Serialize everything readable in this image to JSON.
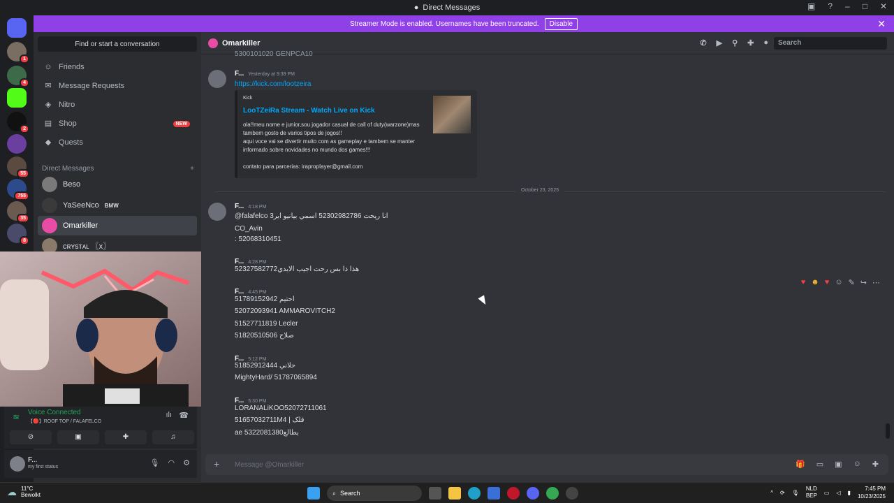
{
  "window": {
    "title": "Direct Messages"
  },
  "banner": {
    "text": "Streamer Mode is enabled. Usernames have been truncated.",
    "button": "Disable"
  },
  "servers": {
    "badges": [
      "1",
      "4",
      "2",
      "55",
      "755",
      "35",
      "8"
    ]
  },
  "sidebar": {
    "find": "Find or start a conversation",
    "nav": [
      {
        "label": "Friends",
        "icon": "friends-icon"
      },
      {
        "label": "Message Requests",
        "icon": "mail-icon"
      },
      {
        "label": "Nitro",
        "icon": "nitro-icon"
      },
      {
        "label": "Shop",
        "icon": "shop-icon",
        "badge": "NEW"
      },
      {
        "label": "Quests",
        "icon": "quests-icon"
      }
    ],
    "dm_header": "Direct Messages",
    "dm_add": "+",
    "dms": [
      {
        "name": "Beso"
      },
      {
        "name": "YaSeeNco",
        "tag": "BMW"
      },
      {
        "name": "Omarkiller"
      },
      {
        "name": "ᴄʀʏsᴛᴀʟ 〖x〗"
      }
    ]
  },
  "voice": {
    "status": "Voice Connected",
    "channel": "【🔴】ROOF TOP / FALAFELCO"
  },
  "user": {
    "name": "F...",
    "status": "my first status"
  },
  "chat": {
    "header_name": "Omarkiller",
    "search_placeholder": "Search",
    "composer_placeholder": "Message @Omarkiller",
    "top_cut": "5300101020 GENPCA10",
    "messages": [
      {
        "author": "F...",
        "time": "Yesterday at 9:39 PM",
        "lines": [
          "https://kick.com/lootzeira"
        ],
        "embed": {
          "provider": "Kick",
          "title": "LooTZeiRa Stream - Watch Live on Kick",
          "desc": "ola!!meu nome e junior,sou jogador casual de call of duty(warzone)mas tambem gosto de varios tipos de jogos!!\naqui voce vai se divertir muito com as gameplay e tambem se manter informado sobre novidades no mundo dos games!!!\n\ncontato para parcerias: irapropIayer@gmail.com"
        }
      },
      {
        "author": "F...",
        "time": "4:18 PM",
        "lines": [
          "@falafelco انا ريحت 52302982786 اسمي بيانيو اير3",
          "CO_Avin",
          ": 52068310451"
        ]
      },
      {
        "author": "F...",
        "time": "4:28 PM",
        "lines": [
          "52327582772هذا ذا بس رحت اجيب الايدي"
        ]
      },
      {
        "author": "F...",
        "time": "4:45 PM",
        "lines": [
          "احتيم 51789152942",
          "52072093941 AMMAROVITCH2",
          "51527711819 Lecler",
          "صلاح 51820510506"
        ]
      },
      {
        "author": "F...",
        "time": "5:12 PM",
        "lines": [
          "حلاني 51852912444",
          "MightyHard/ 51787065894"
        ]
      },
      {
        "author": "F...",
        "time": "5:30 PM",
        "lines": [
          "LORANALiKOO52072711061",
          "51657032711M4 | ﻗﻠﮏ",
          "ae بطالع5322081380"
        ]
      }
    ],
    "date_divider": "October 23, 2025"
  },
  "taskbar": {
    "temp": "11°C",
    "weather": "Bewolkt",
    "search": "Search",
    "lang1": "NLD",
    "lang2": "BEP",
    "time": "7:45 PM",
    "date": "10/23/2025"
  }
}
